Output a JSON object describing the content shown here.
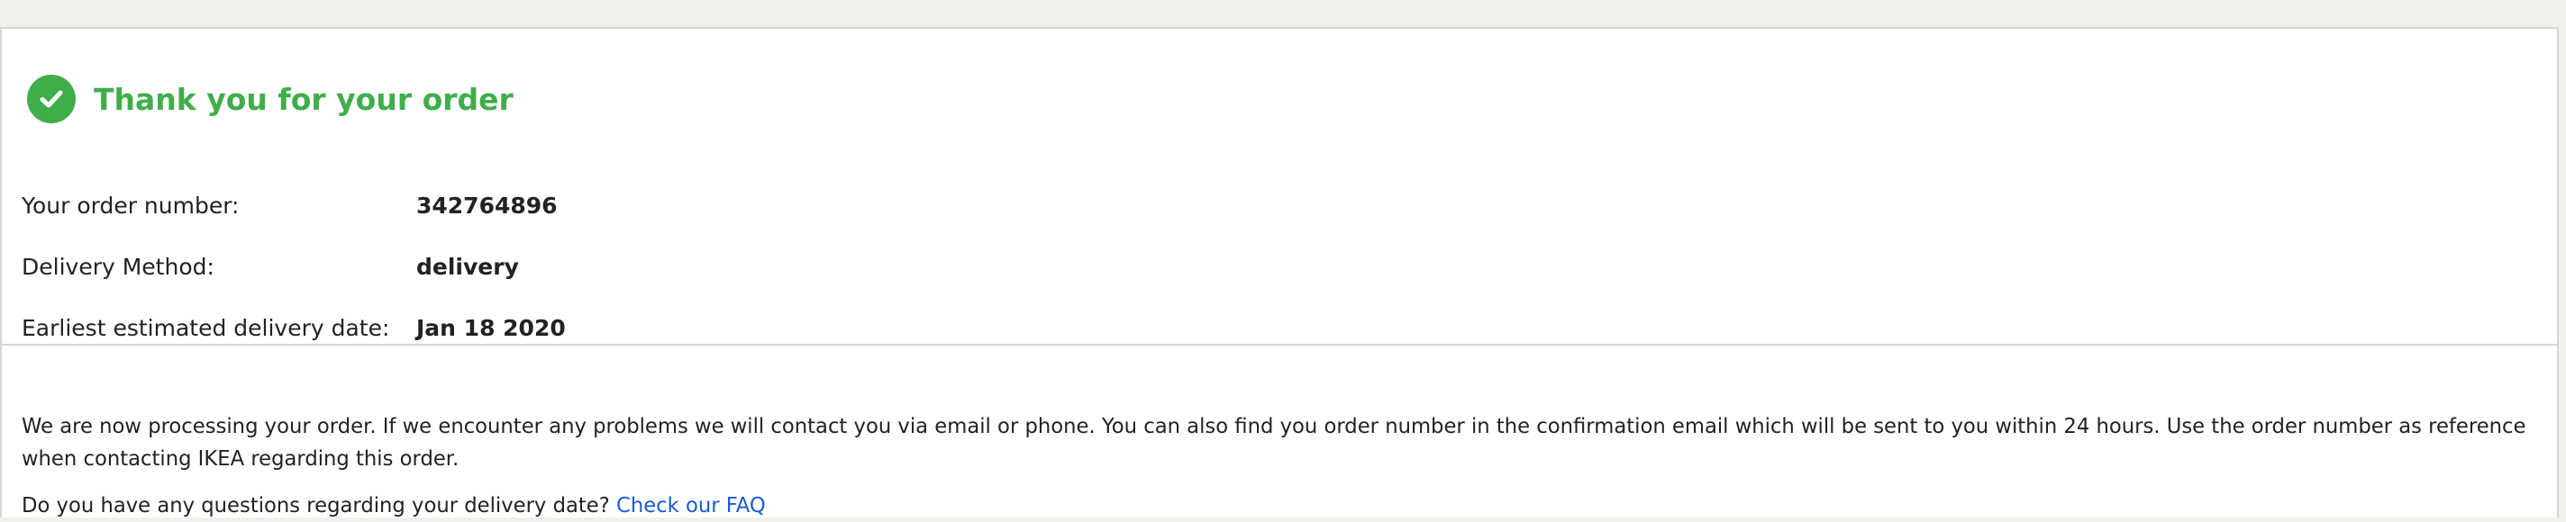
{
  "confirmation": {
    "title": "Thank you for your order",
    "check_icon": "check-circle-icon",
    "accent_color": "#3fae4a"
  },
  "order_details": [
    {
      "label": "Your order number:",
      "value": "342764896"
    },
    {
      "label": "Delivery Method:",
      "value": "delivery"
    },
    {
      "label": "Earliest estimated delivery date:",
      "value": "Jan 18 2020"
    }
  ],
  "info": {
    "message": "We are now processing your order. If we encounter any problems we will contact you via email or phone. You can also find you order number in the confirmation email which will be sent to you within 24 hours. Use the order number as reference when contacting IKEA regarding this order.",
    "question_text": "Do you have any questions regarding your delivery date?",
    "faq_link_label": "Check our FAQ",
    "link_color": "#1a5bd6"
  }
}
